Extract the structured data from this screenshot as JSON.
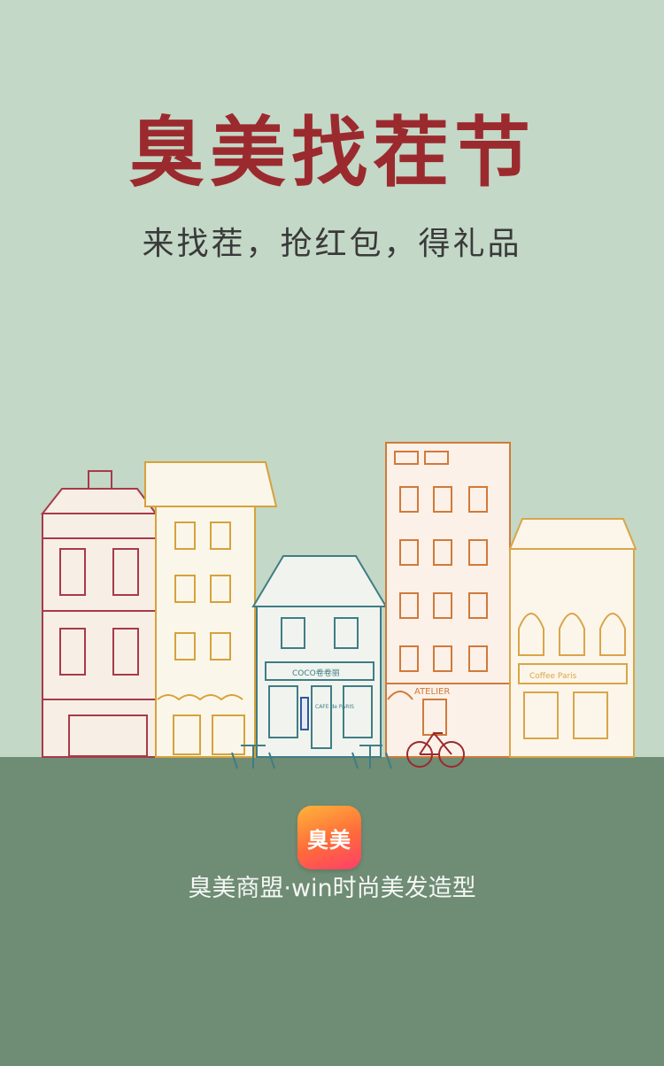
{
  "poster": {
    "title": "臭美找茬节",
    "subtitle": "来找茬，抢红包，得礼品",
    "colors": {
      "sky": "#c3d8c6",
      "ground": "#6f8c74",
      "title": "#9b2a2e"
    }
  },
  "street_signs": {
    "coco_shop": "COCO卷卷丽",
    "cafe": "CAFE de PARIS",
    "atelier": "ATELIER",
    "coffee": "Coffee Paris"
  },
  "brand": {
    "app_icon_label": "臭美",
    "name": "臭美商盟·win时尚美发造型"
  }
}
